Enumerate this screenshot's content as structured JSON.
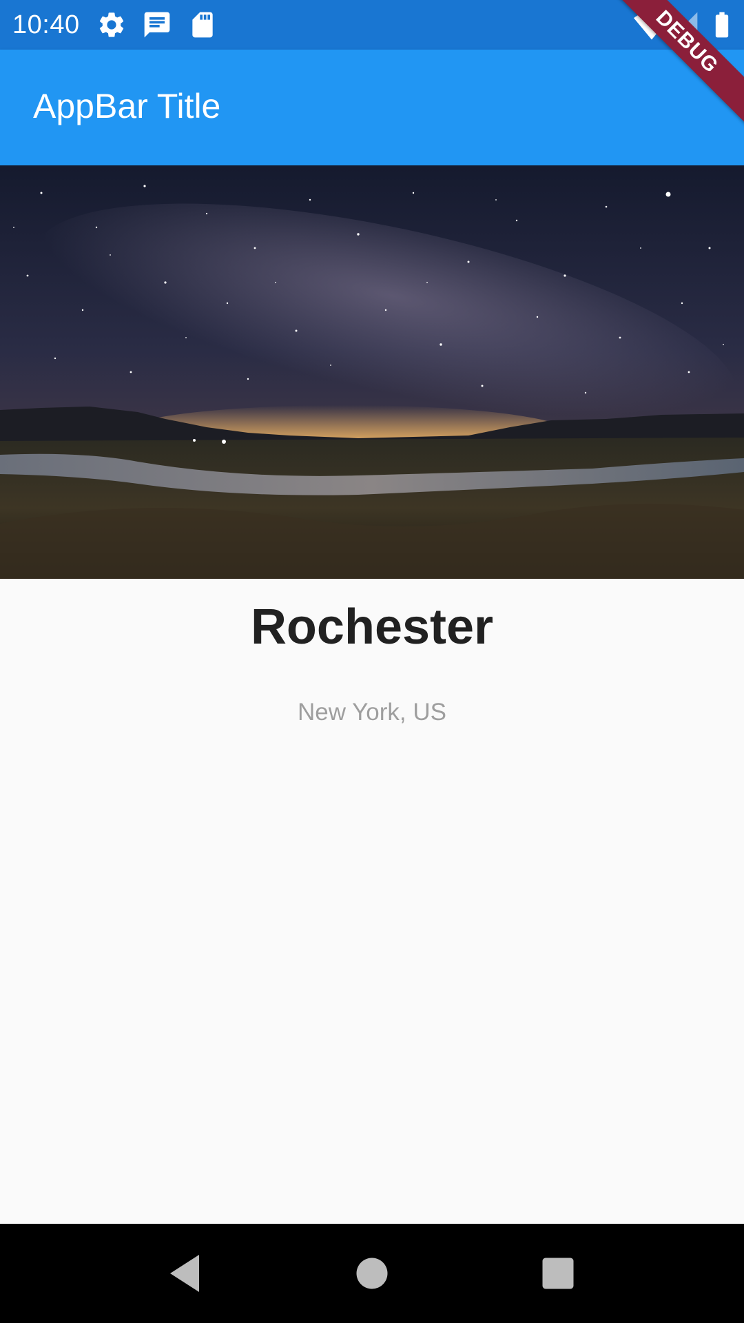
{
  "status_bar": {
    "time": "10:40",
    "left_icons": [
      "gear-icon",
      "message-icon",
      "sd-card-icon"
    ],
    "right_icons": [
      "wifi-icon",
      "signal-icon",
      "battery-icon"
    ],
    "background": "#1976d2"
  },
  "debug_banner": {
    "label": "DEBUG",
    "color": "#8b1f3a"
  },
  "app_bar": {
    "title": "AppBar Title",
    "background": "#2196f3"
  },
  "hero": {
    "icon": "night-sky-landscape-image"
  },
  "place": {
    "name": "Rochester",
    "location": "New York, US"
  },
  "nav_bar": {
    "buttons": [
      "back-icon",
      "home-icon",
      "recents-icon"
    ]
  }
}
